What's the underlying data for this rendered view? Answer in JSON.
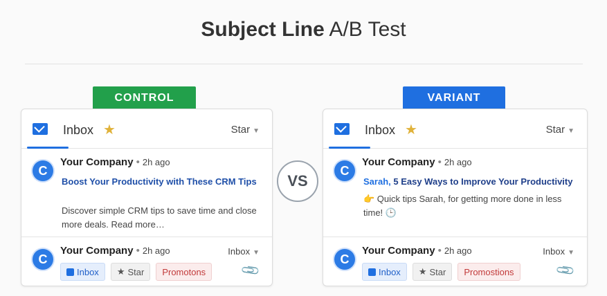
{
  "title_bold": "Subject Line",
  "title_light": "A/B Test",
  "vs_label": "VS",
  "control": {
    "tag": "CONTROL",
    "header": {
      "inbox_label": "Inbox",
      "star_menu": "Star"
    },
    "message": {
      "avatar": "C",
      "sender": "Your Company",
      "time": "2h ago",
      "subject": "Boost Your Productivity with These CRM Tips",
      "preview": "Discover simple CRM tips to save time and close more deals. Read more…"
    },
    "footer": {
      "avatar": "C",
      "sender": "Your Company",
      "time": "2h ago",
      "inbox_menu": "Inbox",
      "chips": {
        "inbox": "Inbox",
        "star": "Star",
        "promo": "Promotons"
      }
    }
  },
  "variant": {
    "tag": "VARIANT",
    "header": {
      "inbox_label": "Inbox",
      "star_menu": "Star"
    },
    "message": {
      "avatar": "C",
      "sender": "Your Company",
      "time": "2h ago",
      "subject_name": "Sarah,",
      "subject_rest": " 5 Easy Ways to Improve Your Productivity",
      "preview": "👉 Quick tips Sarah, for getting more done in less time! 🕒"
    },
    "footer": {
      "avatar": "C",
      "sender": "Your Company",
      "time": "2h ago",
      "inbox_menu": "Inbox",
      "chips": {
        "inbox": "Inbox",
        "star": "Star",
        "promo": "Promostions"
      }
    }
  },
  "colors": {
    "control": "#22a04b",
    "variant": "#1f6fe0",
    "star": "#e0b23a"
  },
  "icons": [
    "mail-icon",
    "star-icon",
    "chevron-down-icon",
    "paperclip-icon"
  ]
}
